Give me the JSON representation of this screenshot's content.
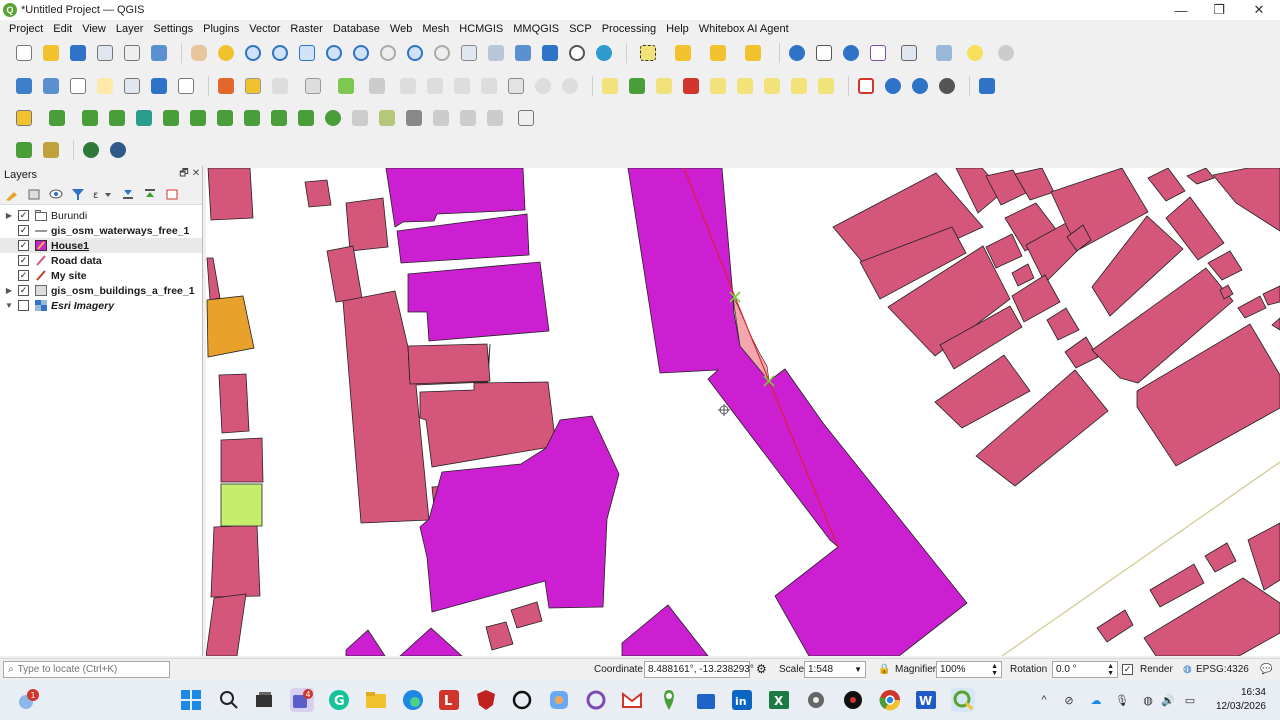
{
  "window": {
    "title": "*Untitled Project — QGIS",
    "logo_letter": "Q",
    "minimize": "—",
    "maximize": "❐",
    "close": "✕"
  },
  "menubar": [
    "Project",
    "Edit",
    "View",
    "Layer",
    "Settings",
    "Plugins",
    "Vector",
    "Raster",
    "Database",
    "Web",
    "Mesh",
    "HCMGIS",
    "MMQGIS",
    "SCP",
    "Processing",
    "Help",
    "Whitebox AI Agent"
  ],
  "toolbar_colors": {
    "blue": "#2f73c9",
    "yellow": "#f2c12e",
    "green": "#4a9e3a",
    "grey": "#9a9a9a",
    "red": "#d0362c",
    "purple": "#7d4bb0",
    "teal": "#2a9d8f"
  },
  "layers_panel": {
    "title": "Layers",
    "float_btn": "🗗",
    "close_btn": "✕",
    "layers": [
      {
        "name": "Burundi",
        "checked": "✓",
        "expander": "▶",
        "icon": "group-icon"
      },
      {
        "name": "gis_osm_waterways_free_1",
        "checked": "✓",
        "expander": "",
        "icon": "line-layer-icon"
      },
      {
        "name": "House1",
        "checked": "✓",
        "expander": "",
        "icon": "polygon-edit-icon"
      },
      {
        "name": "Road data",
        "checked": "✓",
        "expander": "",
        "icon": "line-layer-icon"
      },
      {
        "name": "My site",
        "checked": "✓",
        "expander": "",
        "icon": "line-layer-icon"
      },
      {
        "name": "gis_osm_buildings_a_free_1",
        "checked": "✓",
        "expander": "▶",
        "icon": "polygon-layer-icon"
      },
      {
        "name": "Esri Imagery",
        "checked": "",
        "expander": "▼",
        "icon": "raster-layer-icon"
      }
    ]
  },
  "map_colors": {
    "buildings": "#d4567a",
    "house1": "#cc1fd1",
    "highlight": "#f2a6ad",
    "orange": "#e8a22b",
    "lime": "#c6ee6c",
    "edit_line": "#e0202a",
    "vertex": "#7cc93a",
    "road": "#cfc98a"
  },
  "statusbar": {
    "locator_placeholder": "Type to locate (Ctrl+K)",
    "coordinate_label": "Coordinate",
    "coordinate_value": "8.488161°, -13.238293°",
    "scale_label": "Scale",
    "scale_value": "1:548",
    "magnifier_label": "Magnifier",
    "magnifier_value": "100%",
    "rotation_label": "Rotation",
    "rotation_value": "0.0 °",
    "render_label": "Render",
    "render_checked": "✓",
    "crs": "EPSG:4326"
  },
  "taskbar": {
    "notification_badge": "1",
    "teams_badge": "4",
    "time": "16:34",
    "date": "12/03/2026"
  }
}
